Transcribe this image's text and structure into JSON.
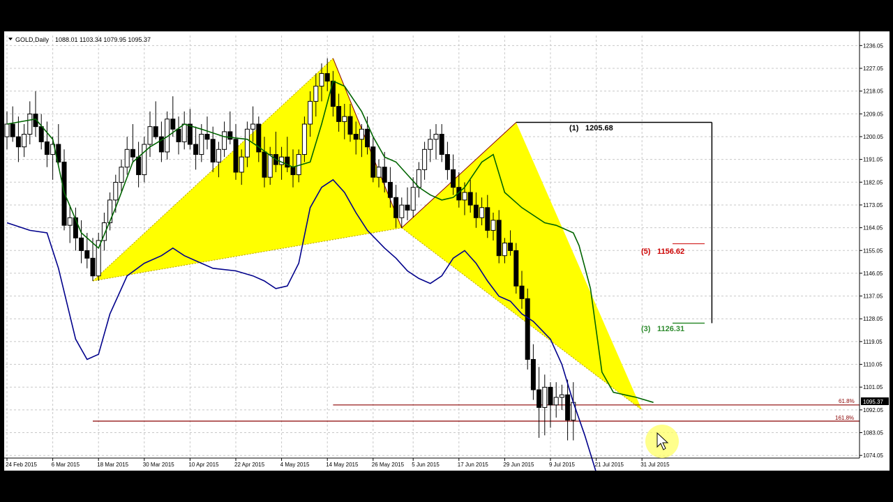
{
  "header": {
    "symbol": "GOLD,Daily",
    "ohlc": "1088.01 1103.34 1079.95 1095.37"
  },
  "colors": {
    "background": "#ffffff",
    "grid": "#c8c8c8",
    "bull_candle": "#ffffff",
    "bear_candle": "#000000",
    "pattern_fill": "#ffff00",
    "pattern_edge": "#8b0000",
    "fast_ma": "#006400",
    "slow_ma": "#00008b",
    "level_line": "#8b0000",
    "level_green": "#2e8b2e",
    "level_red": "#cc0000"
  },
  "chart_data": {
    "type": "candlestick",
    "symbol": "GOLD",
    "timeframe": "Daily",
    "last_ohlc": {
      "open": 1088.01,
      "high": 1103.34,
      "low": 1079.95,
      "close": 1095.37
    },
    "current_price_label": "1095.37",
    "y_ticks": [
      "1236.05",
      "1227.05",
      "1218.05",
      "1209.05",
      "1200.05",
      "1191.05",
      "1182.05",
      "1173.05",
      "1164.05",
      "1155.05",
      "1146.05",
      "1137.05",
      "1128.05",
      "1119.05",
      "1110.05",
      "1101.05",
      "1092.05",
      "1083.05",
      "1074.05"
    ],
    "ylim": [
      1073,
      1240
    ],
    "x_ticks": [
      "24 Feb 2015",
      "6 Mar 2015",
      "18 Mar 2015",
      "30 Mar 2015",
      "10 Apr 2015",
      "22 Apr 2015",
      "4 May 2015",
      "14 May 2015",
      "26 May 2015",
      "5 Jun 2015",
      "17 Jun 2015",
      "29 Jun 2015",
      "9 Jul 2015",
      "21 Jul 2015",
      "31 Jul 2015"
    ],
    "total_bars": 113,
    "x_tick_bar_index": [
      0,
      8,
      16,
      24,
      32,
      40,
      48,
      56,
      64,
      71,
      79,
      87,
      95,
      103,
      111
    ],
    "patterns": [
      {
        "name": "butterfly-1",
        "points": [
          [
            15,
            1143
          ],
          [
            57,
            1231
          ],
          [
            69,
            1164
          ],
          [
            89,
            1205.7
          ],
          [
            111,
            1092
          ]
        ]
      }
    ],
    "targets_box": {
      "start_bar": 89,
      "end_bar": 122,
      "top": 1205.68,
      "bottom": 1126.31
    },
    "levels": [
      {
        "label": "(1)",
        "value_text": "1205.68",
        "value": 1205.68,
        "color": "#000000"
      },
      {
        "label": "(5)",
        "value_text": "1156.62",
        "value": 1156.62,
        "color": "#cc0000"
      },
      {
        "label": "(3)",
        "value_text": "1126.31",
        "value": 1126.31,
        "color": "#2e8b2e"
      }
    ],
    "fib_lines": [
      {
        "label": "61.8%",
        "value": 1094.0,
        "start_bar": 57
      },
      {
        "label": "161.8%",
        "value": 1087.6,
        "start_bar": 15
      }
    ],
    "moving_averages": [
      {
        "name": "fast",
        "color": "#006400",
        "points": [
          [
            0,
            1205
          ],
          [
            5,
            1207
          ],
          [
            8,
            1199
          ],
          [
            10,
            1178
          ],
          [
            13,
            1162
          ],
          [
            16,
            1156
          ],
          [
            19,
            1172
          ],
          [
            22,
            1190
          ],
          [
            25,
            1196
          ],
          [
            28,
            1200
          ],
          [
            31,
            1205
          ],
          [
            34,
            1203
          ],
          [
            38,
            1200
          ],
          [
            42,
            1199
          ],
          [
            44,
            1196
          ],
          [
            47,
            1191
          ],
          [
            50,
            1188
          ],
          [
            53,
            1190
          ],
          [
            55,
            1205
          ],
          [
            57,
            1222
          ],
          [
            59,
            1220
          ],
          [
            62,
            1210
          ],
          [
            64,
            1200
          ],
          [
            66,
            1192
          ],
          [
            68,
            1190
          ],
          [
            70,
            1185
          ],
          [
            72,
            1180
          ],
          [
            74,
            1177
          ],
          [
            76,
            1175
          ],
          [
            78,
            1176
          ],
          [
            80,
            1180
          ],
          [
            83,
            1190
          ],
          [
            85,
            1193
          ],
          [
            87,
            1178
          ],
          [
            90,
            1172
          ],
          [
            94,
            1166
          ],
          [
            96,
            1165
          ],
          [
            99,
            1162
          ],
          [
            100,
            1157
          ],
          [
            102,
            1140
          ],
          [
            104,
            1107
          ],
          [
            106,
            1099
          ],
          [
            108,
            1098
          ],
          [
            110,
            1097
          ],
          [
            113,
            1095
          ]
        ]
      },
      {
        "name": "slow",
        "color": "#00008b",
        "points": [
          [
            0,
            1166
          ],
          [
            4,
            1163
          ],
          [
            7,
            1162
          ],
          [
            9,
            1148
          ],
          [
            12,
            1120
          ],
          [
            14,
            1112
          ],
          [
            16,
            1114
          ],
          [
            18,
            1130
          ],
          [
            21,
            1145
          ],
          [
            24,
            1150
          ],
          [
            27,
            1153
          ],
          [
            29,
            1156
          ],
          [
            31,
            1153
          ],
          [
            34,
            1150
          ],
          [
            36,
            1148
          ],
          [
            40,
            1147
          ],
          [
            43,
            1145
          ],
          [
            45,
            1143
          ],
          [
            47,
            1140
          ],
          [
            49,
            1141
          ],
          [
            51,
            1150
          ],
          [
            53,
            1172
          ],
          [
            55,
            1180
          ],
          [
            57,
            1183
          ],
          [
            59,
            1178
          ],
          [
            61,
            1170
          ],
          [
            63,
            1163
          ],
          [
            66,
            1156
          ],
          [
            68,
            1152
          ],
          [
            70,
            1147
          ],
          [
            72,
            1144
          ],
          [
            74,
            1142
          ],
          [
            76,
            1145
          ],
          [
            78,
            1152
          ],
          [
            80,
            1155
          ],
          [
            82,
            1150
          ],
          [
            84,
            1143
          ],
          [
            86,
            1137
          ],
          [
            88,
            1135
          ],
          [
            90,
            1130
          ],
          [
            92,
            1127
          ],
          [
            95,
            1120
          ],
          [
            97,
            1110
          ],
          [
            99,
            1095
          ],
          [
            101,
            1082
          ],
          [
            104,
            1060
          ]
        ]
      }
    ],
    "candles": [
      [
        1200,
        1210,
        1195,
        1205
      ],
      [
        1205,
        1212,
        1198,
        1200
      ],
      [
        1200,
        1208,
        1190,
        1196
      ],
      [
        1196,
        1205,
        1192,
        1201
      ],
      [
        1201,
        1214,
        1197,
        1209
      ],
      [
        1209,
        1218,
        1200,
        1204
      ],
      [
        1204,
        1209,
        1195,
        1198
      ],
      [
        1198,
        1206,
        1188,
        1193
      ],
      [
        1193,
        1200,
        1183,
        1197
      ],
      [
        1197,
        1205,
        1189,
        1190
      ],
      [
        1190,
        1195,
        1163,
        1165
      ],
      [
        1165,
        1173,
        1158,
        1168
      ],
      [
        1168,
        1172,
        1155,
        1160
      ],
      [
        1160,
        1167,
        1150,
        1155
      ],
      [
        1155,
        1162,
        1148,
        1152
      ],
      [
        1152,
        1160,
        1143,
        1145
      ],
      [
        1145,
        1162,
        1143,
        1159
      ],
      [
        1159,
        1170,
        1155,
        1166
      ],
      [
        1166,
        1178,
        1163,
        1175
      ],
      [
        1175,
        1185,
        1170,
        1182
      ],
      [
        1182,
        1191,
        1178,
        1188
      ],
      [
        1188,
        1200,
        1185,
        1195
      ],
      [
        1195,
        1205,
        1190,
        1192
      ],
      [
        1192,
        1198,
        1180,
        1185
      ],
      [
        1185,
        1200,
        1182,
        1197
      ],
      [
        1197,
        1210,
        1192,
        1204
      ],
      [
        1204,
        1214,
        1199,
        1200
      ],
      [
        1200,
        1206,
        1190,
        1194
      ],
      [
        1194,
        1210,
        1191,
        1207
      ],
      [
        1207,
        1216,
        1200,
        1203
      ],
      [
        1203,
        1208,
        1193,
        1198
      ],
      [
        1198,
        1210,
        1195,
        1205
      ],
      [
        1205,
        1211,
        1195,
        1197
      ],
      [
        1197,
        1204,
        1187,
        1193
      ],
      [
        1193,
        1205,
        1190,
        1201
      ],
      [
        1201,
        1208,
        1195,
        1199
      ],
      [
        1199,
        1204,
        1186,
        1190
      ],
      [
        1190,
        1198,
        1184,
        1195
      ],
      [
        1195,
        1206,
        1192,
        1202
      ],
      [
        1202,
        1210,
        1197,
        1199
      ],
      [
        1199,
        1205,
        1183,
        1186
      ],
      [
        1186,
        1195,
        1181,
        1192
      ],
      [
        1192,
        1206,
        1188,
        1203
      ],
      [
        1203,
        1212,
        1198,
        1205
      ],
      [
        1205,
        1208,
        1190,
        1194
      ],
      [
        1194,
        1200,
        1180,
        1184
      ],
      [
        1184,
        1196,
        1181,
        1193
      ],
      [
        1193,
        1202,
        1186,
        1189
      ],
      [
        1189,
        1196,
        1183,
        1192
      ],
      [
        1192,
        1200,
        1186,
        1188
      ],
      [
        1188,
        1195,
        1180,
        1185
      ],
      [
        1185,
        1195,
        1182,
        1193
      ],
      [
        1193,
        1208,
        1190,
        1205
      ],
      [
        1205,
        1218,
        1200,
        1214
      ],
      [
        1214,
        1225,
        1208,
        1220
      ],
      [
        1220,
        1229,
        1214,
        1225
      ],
      [
        1225,
        1231,
        1218,
        1222
      ],
      [
        1222,
        1226,
        1208,
        1212
      ],
      [
        1212,
        1217,
        1202,
        1206
      ],
      [
        1206,
        1213,
        1199,
        1208
      ],
      [
        1208,
        1213,
        1198,
        1201
      ],
      [
        1201,
        1206,
        1193,
        1199
      ],
      [
        1199,
        1205,
        1192,
        1203
      ],
      [
        1203,
        1208,
        1193,
        1196
      ],
      [
        1196,
        1200,
        1182,
        1184
      ],
      [
        1184,
        1191,
        1180,
        1188
      ],
      [
        1188,
        1194,
        1178,
        1182
      ],
      [
        1182,
        1188,
        1172,
        1176
      ],
      [
        1176,
        1181,
        1164,
        1168
      ],
      [
        1168,
        1176,
        1164,
        1173
      ],
      [
        1173,
        1180,
        1167,
        1171
      ],
      [
        1171,
        1184,
        1168,
        1180
      ],
      [
        1180,
        1190,
        1176,
        1187
      ],
      [
        1187,
        1198,
        1183,
        1195
      ],
      [
        1195,
        1203,
        1190,
        1199
      ],
      [
        1199,
        1205,
        1191,
        1201
      ],
      [
        1201,
        1205,
        1190,
        1193
      ],
      [
        1193,
        1198,
        1183,
        1187
      ],
      [
        1187,
        1193,
        1177,
        1180
      ],
      [
        1180,
        1186,
        1172,
        1175
      ],
      [
        1175,
        1182,
        1169,
        1178
      ],
      [
        1178,
        1183,
        1170,
        1173
      ],
      [
        1173,
        1178,
        1164,
        1168
      ],
      [
        1168,
        1176,
        1165,
        1172
      ],
      [
        1172,
        1177,
        1160,
        1163
      ],
      [
        1163,
        1170,
        1159,
        1167
      ],
      [
        1167,
        1171,
        1150,
        1153
      ],
      [
        1153,
        1160,
        1150,
        1158
      ],
      [
        1158,
        1163,
        1153,
        1155
      ],
      [
        1155,
        1158,
        1138,
        1141
      ],
      [
        1141,
        1147,
        1132,
        1136
      ],
      [
        1136,
        1140,
        1108,
        1112
      ],
      [
        1112,
        1118,
        1096,
        1100
      ],
      [
        1100,
        1109,
        1081,
        1093
      ],
      [
        1093,
        1106,
        1082,
        1101
      ],
      [
        1101,
        1103,
        1085,
        1094
      ],
      [
        1094,
        1103,
        1089,
        1097
      ],
      [
        1097,
        1102,
        1092,
        1098
      ],
      [
        1098,
        1104,
        1080,
        1088
      ],
      [
        1088,
        1103,
        1080,
        1095
      ]
    ]
  }
}
